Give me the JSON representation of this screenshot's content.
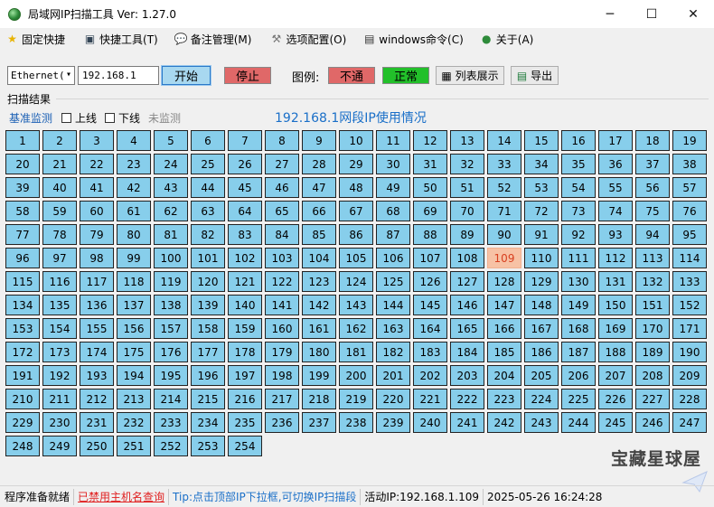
{
  "window": {
    "title": "局域网IP扫描工具  Ver: 1.27.0",
    "minimize": "─",
    "maximize": "☐",
    "close": "✕"
  },
  "menu": [
    {
      "label": "固定快捷",
      "icon": "star-icon",
      "glyph": "★",
      "color": "#e8b300"
    },
    {
      "label": "快捷工具(T)",
      "icon": "tools-icon",
      "glyph": "▣",
      "color": "#345"
    },
    {
      "label": "备注管理(M)",
      "icon": "chat-icon",
      "glyph": "💬",
      "color": "#2a7ad8"
    },
    {
      "label": "选项配置(O)",
      "icon": "wrench-icon",
      "glyph": "⚒",
      "color": "#777"
    },
    {
      "label": "windows命令(C)",
      "icon": "terminal-icon",
      "glyph": "▤",
      "color": "#333"
    },
    {
      "label": "关于(A)",
      "icon": "globe-icon",
      "glyph": "●",
      "color": "#2e8b3a"
    }
  ],
  "toolbar": {
    "adapter": "Ethernet(",
    "ip_value": "192.168.1",
    "start_label": "开始",
    "stop_label": "停止",
    "legend_label": "图例:",
    "legend_unreachable": "不通",
    "legend_normal": "正常",
    "list_label": "列表展示",
    "export_label": "导出"
  },
  "scan": {
    "group_label": "扫描结果",
    "base_monitor": "基准监测",
    "online": "上线",
    "offline": "下线",
    "unmonitored": "未监测",
    "title": "192.168.1网段IP使用情况",
    "columns": 19,
    "count": 254,
    "highlight": 109
  },
  "status": {
    "ready": "程序准备就绪",
    "disabled": "已禁用主机名查询",
    "tip": "Tip:点击顶部IP下拉框,可切换IP扫描段",
    "active_ip": "活动IP:192.168.1.109",
    "datetime": "2025-05-26  16:24:28"
  },
  "watermark": "宝藏星球屋",
  "colors": {
    "cell": "#87ceeb",
    "active_cell": "#f7c2a5",
    "stop": "#e06868",
    "normal": "#22c02a",
    "accent": "#1a6fc8"
  }
}
